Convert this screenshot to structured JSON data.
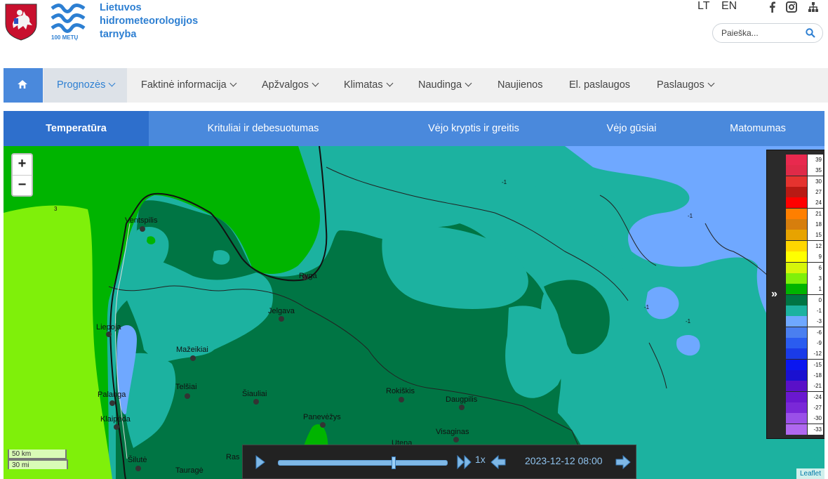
{
  "header": {
    "org_name_lines": [
      "Lietuvos",
      "hidrometeorologijos",
      "tarnyba"
    ],
    "logo_caption": "100 METŲ",
    "languages": [
      "LT",
      "EN"
    ],
    "social_icons": [
      "facebook-icon",
      "instagram-icon",
      "sitemap-icon"
    ],
    "search": {
      "placeholder": "Paieška..."
    }
  },
  "nav": {
    "home_icon": "home-icon",
    "items": [
      {
        "label": "Prognozės",
        "dropdown": true,
        "active": true
      },
      {
        "label": "Faktinė informacija",
        "dropdown": true
      },
      {
        "label": "Apžvalgos",
        "dropdown": true
      },
      {
        "label": "Klimatas",
        "dropdown": true
      },
      {
        "label": "Naudinga",
        "dropdown": true
      },
      {
        "label": "Naujienos",
        "dropdown": false
      },
      {
        "label": "El. paslaugos",
        "dropdown": false
      },
      {
        "label": "Paslaugos",
        "dropdown": true
      }
    ]
  },
  "tabs": [
    "Temperatūra",
    "Krituliai ir debesuotumas",
    "Vėjo kryptis ir greitis",
    "Vėjo gūsiai",
    "Matomumas"
  ],
  "active_tab": "Temperatūra",
  "map": {
    "zoom_in": "+",
    "zoom_out": "−",
    "small_labels": [
      "3",
      "-1",
      "-1",
      "-1",
      "-1",
      "-1"
    ],
    "cities": [
      "Ventspilis",
      "Ryga",
      "Jelgava",
      "Liepoja",
      "Mažeikiai",
      "Telšiai",
      "Šiauliai",
      "Rokiškis",
      "Daugpilis",
      "Palanga",
      "Klaipėda",
      "Panevėžys",
      "Visaginas",
      "Utena",
      "Šilutė",
      "Tauragė",
      "Ras"
    ],
    "scale": {
      "km": "50 km",
      "mi": "30 mi"
    },
    "attribution": "Leaflet",
    "legend": {
      "expand_icon": "double-chevron-right-icon",
      "steps": [
        {
          "label": "39",
          "color": "#e8294e"
        },
        {
          "label": "35",
          "color": "#df2a48"
        },
        {
          "label": "30",
          "color": "#e5332f"
        },
        {
          "label": "27",
          "color": "#b81a14"
        },
        {
          "label": "24",
          "color": "#ff0000"
        },
        {
          "label": "21",
          "color": "#ff7f00"
        },
        {
          "label": "18",
          "color": "#d67e0d"
        },
        {
          "label": "15",
          "color": "#e7a300"
        },
        {
          "label": "12",
          "color": "#ffd700"
        },
        {
          "label": "9",
          "color": "#ffff00"
        },
        {
          "label": "6",
          "color": "#d6f50a"
        },
        {
          "label": "3",
          "color": "#7ff00a"
        },
        {
          "label": "1",
          "color": "#00b400"
        },
        {
          "label": "0",
          "color": "#007544"
        },
        {
          "label": "-1",
          "color": "#1cb2a0"
        },
        {
          "label": "-3",
          "color": "#6fa8ff"
        },
        {
          "label": "-6",
          "color": "#4a7ff0"
        },
        {
          "label": "-9",
          "color": "#2a5cf0"
        },
        {
          "label": "-12",
          "color": "#1a3be8"
        },
        {
          "label": "-15",
          "color": "#0a16f0"
        },
        {
          "label": "-18",
          "color": "#1a10d0"
        },
        {
          "label": "-21",
          "color": "#5a10c8"
        },
        {
          "label": "-24",
          "color": "#6a18d0"
        },
        {
          "label": "-27",
          "color": "#7a28d8"
        },
        {
          "label": "-30",
          "color": "#9a50e8"
        },
        {
          "label": "-33",
          "color": "#b068f0"
        }
      ]
    }
  },
  "player": {
    "play_icon": "play-icon",
    "forward_icon": "fast-forward-icon",
    "speed": "1x",
    "prev_icon": "arrow-left-icon",
    "next_icon": "arrow-right-icon",
    "datetime": "2023-12-12 08:00",
    "progress": 0.68
  }
}
